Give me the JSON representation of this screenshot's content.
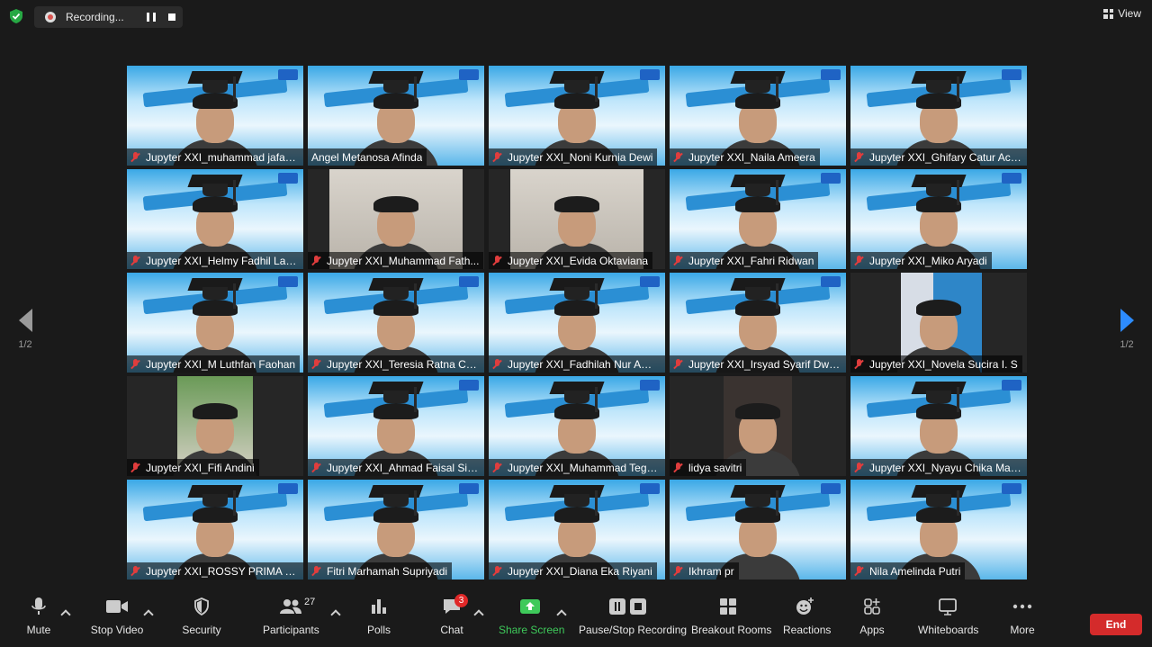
{
  "top_bar": {
    "recording_label": "Recording...",
    "view_label": "View"
  },
  "paging": {
    "left_page": "1/2",
    "right_page": "1/2"
  },
  "participants": [
    {
      "name": "Jupyter XXI_muhammad jafar ...",
      "background": "ceremony",
      "muted": true
    },
    {
      "name": "Angel Metanosa Afinda",
      "background": "ceremony",
      "muted": false,
      "active_speaker": true
    },
    {
      "name": "Jupyter XXI_Noni Kurnia Dewi",
      "background": "ceremony",
      "muted": true
    },
    {
      "name": "Jupyter XXI_Naila Ameera",
      "background": "ceremony",
      "muted": true
    },
    {
      "name": "Jupyter XXI_Ghifary Catur Ach...",
      "background": "ceremony",
      "muted": true
    },
    {
      "name": "Jupyter XXI_Helmy Fadhil Lan...",
      "background": "ceremony",
      "muted": true
    },
    {
      "name": "Jupyter XXI_Muhammad Fath...",
      "background": "wall",
      "muted": true
    },
    {
      "name": "Jupyter XXI_Evida Oktaviana",
      "background": "wall",
      "muted": true
    },
    {
      "name": "Jupyter XXI_Fahri Ridwan",
      "background": "ceremony",
      "muted": true
    },
    {
      "name": "Jupyter XXI_Miko Aryadi",
      "background": "ceremony",
      "muted": true
    },
    {
      "name": "Jupyter XXI_M Luthfan Faohan",
      "background": "ceremony",
      "muted": true
    },
    {
      "name": "Jupyter XXI_Teresia Ratna Cali...",
      "background": "ceremony",
      "muted": true
    },
    {
      "name": "Jupyter XXI_Fadhilah Nur Ama...",
      "background": "ceremony",
      "muted": true
    },
    {
      "name": "Jupyter XXI_Irsyad Syarif Dwi ...",
      "background": "ceremony",
      "muted": true
    },
    {
      "name": "Jupyter XXI_Novela Sucira I. S",
      "background": "blue",
      "muted": true
    },
    {
      "name": "Jupyter XXI_Fifi Andini",
      "background": "green",
      "muted": true
    },
    {
      "name": "Jupyter XXI_Ahmad Faisal Sire...",
      "background": "ceremony",
      "muted": true
    },
    {
      "name": "Jupyter XXI_Muhammad Tega...",
      "background": "ceremony",
      "muted": true
    },
    {
      "name": "lidya savitri",
      "background": "dark",
      "muted": true
    },
    {
      "name": "Jupyter XXI_Nyayu Chika Mar...",
      "background": "ceremony",
      "muted": true
    },
    {
      "name": "Jupyter XXI_ROSSY PRIMA NA...",
      "background": "ceremony",
      "muted": true
    },
    {
      "name": "Fitri Marhamah Supriyadi",
      "background": "ceremony",
      "muted": true
    },
    {
      "name": "Jupyter XXI_Diana Eka Riyani",
      "background": "ceremony",
      "muted": true
    },
    {
      "name": "Ikhram pr",
      "background": "ceremony",
      "muted": true
    },
    {
      "name": "Nila Amelinda Putri",
      "background": "ceremony",
      "muted": true
    }
  ],
  "toolbar": {
    "mute": "Mute",
    "stop_video": "Stop Video",
    "security": "Security",
    "participants": "Participants",
    "participants_count": "27",
    "polls": "Polls",
    "chat": "Chat",
    "chat_badge": "3",
    "share_screen": "Share Screen",
    "pause_stop_recording": "Pause/Stop Recording",
    "breakout_rooms": "Breakout Rooms",
    "reactions": "Reactions",
    "apps": "Apps",
    "whiteboards": "Whiteboards",
    "more": "More",
    "end": "End"
  },
  "colors": {
    "share_green": "#3ec95a",
    "end_red": "#d42b2b",
    "active_border": "#c7d45a",
    "next_arrow": "#2d8cff"
  }
}
